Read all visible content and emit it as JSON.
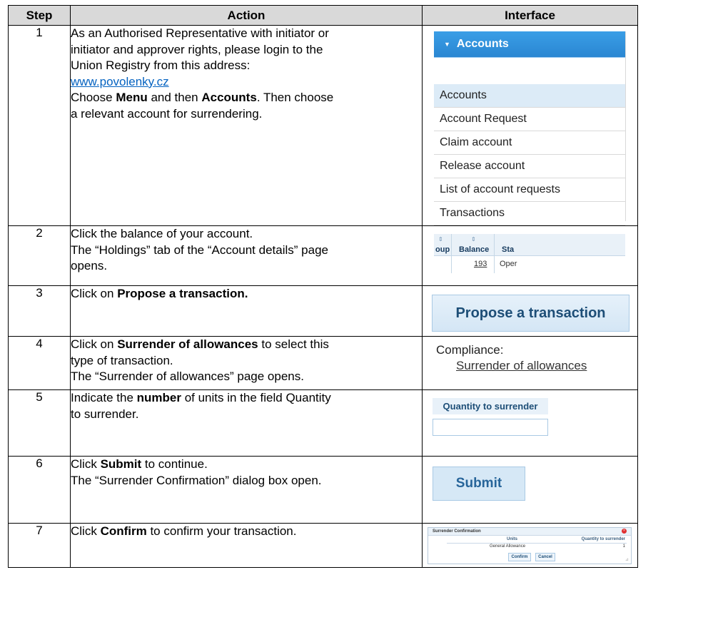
{
  "headers": {
    "step": "Step",
    "action": "Action",
    "interface": "Interface"
  },
  "rows": [
    {
      "step": "1",
      "lines": [
        "As an Authorised Representative with initiator or",
        "initiator and approver rights, please login to the",
        "Union Registry from this address:"
      ],
      "link": "www.povolenky.cz",
      "line_a_pre": "Choose ",
      "line_a_b1": "Menu",
      "line_a_mid": " and then ",
      "line_a_b2": "Accounts",
      "line_a_post": ". Then choose",
      "line_b": "a relevant account for surrendering."
    },
    {
      "step": "2",
      "lines": [
        "Click the balance of your account.",
        "The “Holdings” tab of the “Account details” page",
        "opens."
      ]
    },
    {
      "step": "3",
      "pre": "Click on ",
      "bold": "Propose a transaction."
    },
    {
      "step": "4",
      "pre": "Click on ",
      "bold": "Surrender of allowances",
      "post": " to select this",
      "line2": "type of transaction.",
      "line3": "The “Surrender of allowances” page opens."
    },
    {
      "step": "5",
      "pre": "Indicate the ",
      "bold": "number",
      "post": " of units in the field Quantity",
      "line2": "to surrender."
    },
    {
      "step": "6",
      "pre": "Click ",
      "bold": "Submit",
      "post": " to continue.",
      "line2": "The “Surrender Confirmation” dialog box open."
    },
    {
      "step": "7",
      "pre": "Click ",
      "bold": "Confirm",
      "post": " to confirm your transaction."
    }
  ],
  "ui": {
    "accounts_menu": {
      "header": "Accounts",
      "items": [
        "Accounts",
        "Account Request",
        "Claim account",
        "Release account",
        "List of account requests",
        "Transactions"
      ]
    },
    "balance_table": {
      "col_left": "oup",
      "col_balance": "Balance",
      "col_status": "Sta",
      "balance_value": "193",
      "status_value": "Oper"
    },
    "propose_button": "Propose a transaction",
    "compliance": {
      "label": "Compliance:",
      "link": "Surrender of allowances"
    },
    "quantity": {
      "label": "Quantity to surrender"
    },
    "submit_button": "Submit",
    "dialog": {
      "title": "Surrender Confirmation",
      "col_units": "Units",
      "col_quantity": "Quantity to surrender",
      "row_units": "General Allowance",
      "row_quantity": "1",
      "confirm": "Confirm",
      "cancel": "Cancel"
    }
  },
  "colors": {
    "header_bg": "#d9d9d9",
    "link": "#0563c1",
    "menu_blue": "#2a86d2"
  }
}
